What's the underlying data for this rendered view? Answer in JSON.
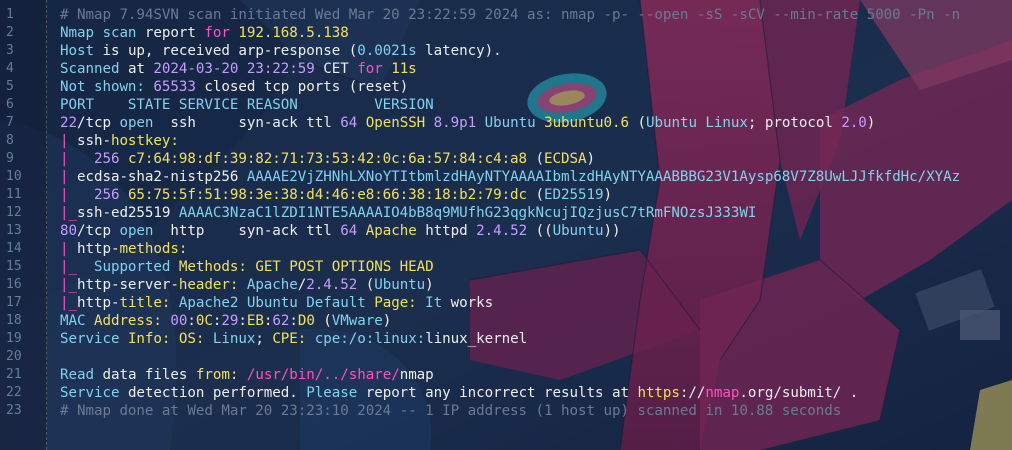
{
  "colors": {
    "background": "#12203a",
    "comment": "#6b7a94",
    "text": "#eeeeee",
    "cyan": "#7fd3ee",
    "yellow": "#f1e15a",
    "magenta": "#ff4fc0",
    "purple": "#c79cff",
    "blue": "#6ea9ff"
  },
  "line_numbers": [
    "1",
    "2",
    "3",
    "4",
    "5",
    "6",
    "7",
    "8",
    "9",
    "10",
    "11",
    "12",
    "13",
    "14",
    "15",
    "16",
    "17",
    "18",
    "19",
    "20",
    "21",
    "22",
    "23"
  ],
  "lines": [
    [
      {
        "c": "c-com",
        "t": "# Nmap 7.94SVN scan initiated Wed Mar 20 23:22:59 2024 as: nmap -p- --open -sS -sCV --min-rate 5000 -Pn -n"
      }
    ],
    [
      {
        "c": "c-cy",
        "t": "Nmap scan "
      },
      {
        "c": "c-txt",
        "t": "report "
      },
      {
        "c": "c-mag",
        "t": "for "
      },
      {
        "c": "c-yel",
        "t": "192.168.5.138"
      }
    ],
    [
      {
        "c": "c-cy",
        "t": "Host "
      },
      {
        "c": "c-txt",
        "t": "is up, received arp-response ("
      },
      {
        "c": "c-cy",
        "t": "0.0021s"
      },
      {
        "c": "c-txt",
        "t": " latency)."
      }
    ],
    [
      {
        "c": "c-cy",
        "t": "Scanned "
      },
      {
        "c": "c-txt",
        "t": "at "
      },
      {
        "c": "c-pur",
        "t": "2024-03-20 23:22:59"
      },
      {
        "c": "c-txt",
        "t": " CET "
      },
      {
        "c": "c-mag",
        "t": "for "
      },
      {
        "c": "c-yel",
        "t": "11s"
      }
    ],
    [
      {
        "c": "c-cy",
        "t": "Not shown: "
      },
      {
        "c": "c-pur",
        "t": "65533"
      },
      {
        "c": "c-txt",
        "t": " closed tcp ports (reset)"
      }
    ],
    [
      {
        "c": "c-cy",
        "t": "PORT    STATE SERVICE REASON         VERSION"
      }
    ],
    [
      {
        "c": "c-pur",
        "t": "22"
      },
      {
        "c": "c-txt",
        "t": "/tcp "
      },
      {
        "c": "c-cy",
        "t": "open  "
      },
      {
        "c": "c-txt",
        "t": "ssh     syn-ack ttl "
      },
      {
        "c": "c-pur",
        "t": "64 "
      },
      {
        "c": "c-yel",
        "t": "OpenSSH "
      },
      {
        "c": "c-pur",
        "t": "8.9p1 "
      },
      {
        "c": "c-cy",
        "t": "Ubuntu "
      },
      {
        "c": "c-yel",
        "t": "3ubuntu0.6"
      },
      {
        "c": "c-txt",
        "t": " ("
      },
      {
        "c": "c-cy",
        "t": "Ubuntu Linux"
      },
      {
        "c": "c-txt",
        "t": "; protocol "
      },
      {
        "c": "c-pur",
        "t": "2.0"
      },
      {
        "c": "c-txt",
        "t": ")"
      }
    ],
    [
      {
        "c": "c-mag",
        "t": "| "
      },
      {
        "c": "c-txt",
        "t": "ssh-"
      },
      {
        "c": "c-yel",
        "t": "hostkey:"
      }
    ],
    [
      {
        "c": "c-mag",
        "t": "|   "
      },
      {
        "c": "c-pur",
        "t": "256 "
      },
      {
        "c": "c-yel",
        "t": "c7:64:98:df:39:82:71:73:53:42:0c:6a:57:84:c4:a8"
      },
      {
        "c": "c-txt",
        "t": " ("
      },
      {
        "c": "c-yel",
        "t": "ECDSA"
      },
      {
        "c": "c-txt",
        "t": ")"
      }
    ],
    [
      {
        "c": "c-mag",
        "t": "| "
      },
      {
        "c": "c-txt",
        "t": "ecdsa-sha2-nistp256 "
      },
      {
        "c": "c-cy",
        "t": "AAAAE2VjZHNhLXNoYTItbmlzdHAyNTYAAAAIbmlzdHAyNTYAAABBBG23V1Aysp68V7Z8UwLJJfkfdHc/XYAz"
      }
    ],
    [
      {
        "c": "c-mag",
        "t": "|   "
      },
      {
        "c": "c-pur",
        "t": "256 "
      },
      {
        "c": "c-yel",
        "t": "65:75:5f:51:98:3e:38:d4:46:e8:66:38:18:b2:79:dc"
      },
      {
        "c": "c-txt",
        "t": " ("
      },
      {
        "c": "c-cy",
        "t": "ED25519"
      },
      {
        "c": "c-txt",
        "t": ")"
      }
    ],
    [
      {
        "c": "c-mag",
        "t": "|_"
      },
      {
        "c": "c-txt",
        "t": "ssh-ed25519 "
      },
      {
        "c": "c-cy",
        "t": "AAAAC3NzaC1lZDI1NTE5AAAAIO4bB8q9MUfhG23qgkNcujIQzjusC7tRmFNOzsJ333WI"
      }
    ],
    [
      {
        "c": "c-pur",
        "t": "80"
      },
      {
        "c": "c-txt",
        "t": "/tcp "
      },
      {
        "c": "c-cy",
        "t": "open  "
      },
      {
        "c": "c-txt",
        "t": "http    syn-ack ttl "
      },
      {
        "c": "c-pur",
        "t": "64 "
      },
      {
        "c": "c-yel",
        "t": "Apache "
      },
      {
        "c": "c-txt",
        "t": "httpd "
      },
      {
        "c": "c-pur",
        "t": "2.4.52"
      },
      {
        "c": "c-txt",
        "t": " (("
      },
      {
        "c": "c-cy",
        "t": "Ubuntu"
      },
      {
        "c": "c-txt",
        "t": "))"
      }
    ],
    [
      {
        "c": "c-mag",
        "t": "| "
      },
      {
        "c": "c-txt",
        "t": "http-"
      },
      {
        "c": "c-yel",
        "t": "methods:"
      }
    ],
    [
      {
        "c": "c-mag",
        "t": "|_  "
      },
      {
        "c": "c-cy",
        "t": "Supported "
      },
      {
        "c": "c-yel",
        "t": "Methods: "
      },
      {
        "c": "c-yel",
        "t": "GET POST OPTIONS HEAD"
      }
    ],
    [
      {
        "c": "c-mag",
        "t": "|_"
      },
      {
        "c": "c-txt",
        "t": "http-server-"
      },
      {
        "c": "c-yel",
        "t": "header: "
      },
      {
        "c": "c-cy",
        "t": "Apache"
      },
      {
        "c": "c-txt",
        "t": "/"
      },
      {
        "c": "c-pur",
        "t": "2.4.52"
      },
      {
        "c": "c-txt",
        "t": " ("
      },
      {
        "c": "c-cy",
        "t": "Ubuntu"
      },
      {
        "c": "c-txt",
        "t": ")"
      }
    ],
    [
      {
        "c": "c-mag",
        "t": "|_"
      },
      {
        "c": "c-txt",
        "t": "http-"
      },
      {
        "c": "c-yel",
        "t": "title: "
      },
      {
        "c": "c-cy",
        "t": "Apache2 Ubuntu Default "
      },
      {
        "c": "c-yel",
        "t": "Page: "
      },
      {
        "c": "c-cy",
        "t": "It "
      },
      {
        "c": "c-txt",
        "t": "works"
      }
    ],
    [
      {
        "c": "c-cy",
        "t": "MAC "
      },
      {
        "c": "c-yel",
        "t": "Address: "
      },
      {
        "c": "c-pur",
        "t": "00"
      },
      {
        "c": "c-txt",
        "t": ":"
      },
      {
        "c": "c-yel",
        "t": "0C"
      },
      {
        "c": "c-txt",
        "t": ":"
      },
      {
        "c": "c-pur",
        "t": "29"
      },
      {
        "c": "c-txt",
        "t": ":"
      },
      {
        "c": "c-yel",
        "t": "EB"
      },
      {
        "c": "c-txt",
        "t": ":"
      },
      {
        "c": "c-pur",
        "t": "62"
      },
      {
        "c": "c-txt",
        "t": ":"
      },
      {
        "c": "c-yel",
        "t": "D0"
      },
      {
        "c": "c-txt",
        "t": " ("
      },
      {
        "c": "c-cy",
        "t": "VMware"
      },
      {
        "c": "c-txt",
        "t": ")"
      }
    ],
    [
      {
        "c": "c-cy",
        "t": "Service "
      },
      {
        "c": "c-yel",
        "t": "Info: OS: "
      },
      {
        "c": "c-cy",
        "t": "Linux"
      },
      {
        "c": "c-txt",
        "t": "; "
      },
      {
        "c": "c-yel",
        "t": "CPE: "
      },
      {
        "c": "c-cy",
        "t": "cpe:/o:linux:"
      },
      {
        "c": "c-txt",
        "t": "linux_kernel"
      }
    ],
    [
      {
        "c": "c-txt",
        "t": ""
      }
    ],
    [
      {
        "c": "c-cy",
        "t": "Read "
      },
      {
        "c": "c-txt",
        "t": "data files "
      },
      {
        "c": "c-yel",
        "t": "from: "
      },
      {
        "c": "c-mag",
        "t": "/usr/bin/../share/"
      },
      {
        "c": "c-txt",
        "t": "nmap"
      }
    ],
    [
      {
        "c": "c-cy",
        "t": "Service "
      },
      {
        "c": "c-txt",
        "t": "detection performed. "
      },
      {
        "c": "c-cy",
        "t": "Please "
      },
      {
        "c": "c-txt",
        "t": "report any incorrect results at "
      },
      {
        "c": "c-yel",
        "t": "https"
      },
      {
        "c": "c-txt",
        "t": "://"
      },
      {
        "c": "c-mag",
        "t": "nmap"
      },
      {
        "c": "c-txt",
        "t": ".org/submit/ ."
      }
    ],
    [
      {
        "c": "c-com",
        "t": "# Nmap done at Wed Mar 20 23:23:10 2024 -- 1 IP address (1 host up) scanned in 10.88 seconds"
      }
    ]
  ]
}
